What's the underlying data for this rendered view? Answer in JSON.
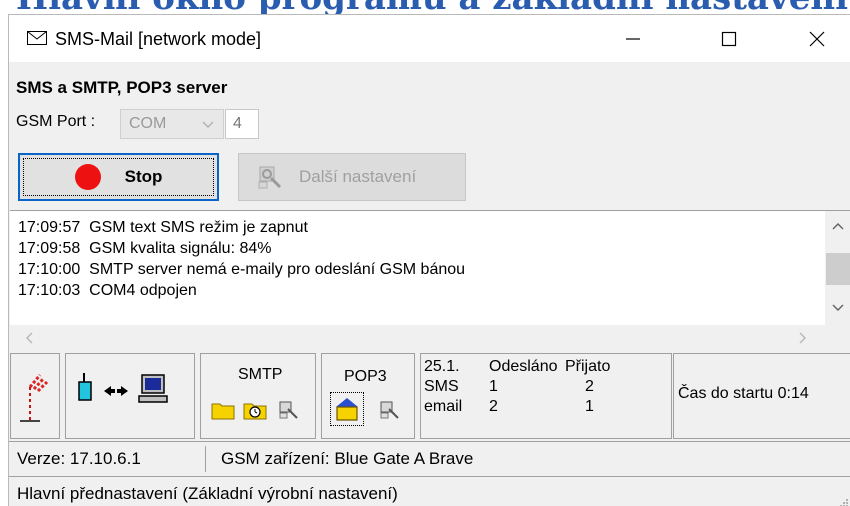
{
  "page": {
    "heading": "Hlavní okno programu a základní nastavení"
  },
  "window": {
    "title": "SMS-Mail  [network mode]"
  },
  "section": {
    "title": "SMS a SMTP, POP3 server"
  },
  "gsm_port": {
    "label": "GSM Port :",
    "select_value": "COM",
    "number": "4"
  },
  "buttons": {
    "stop": "Stop",
    "more_settings": "Další nastavení"
  },
  "log": {
    "lines": [
      "17:09:57  GSM text SMS režim je zapnut",
      "17:09:58  GSM kvalita signálu: 84%",
      "17:10:00  SMTP server nemá e-maily pro odeslání GSM bánou",
      "17:10:03  COM4 odpojen"
    ]
  },
  "panels": {
    "smtp_label": "SMTP",
    "pop3_label": "POP3",
    "stats": {
      "date": "25.1.",
      "sent_header": "Odesláno",
      "received_header": "Přijato",
      "rows": [
        {
          "label": "SMS",
          "sent": "1",
          "received": "2"
        },
        {
          "label": "email",
          "sent": "2",
          "received": "1"
        }
      ]
    },
    "countdown": "Čas do startu 0:14"
  },
  "status": {
    "version": "Verze: 17.10.6.1",
    "device": "GSM zařízení: Blue Gate A Brave",
    "preset": "Hlavní přednastavení (Základní výrobní nastavení)"
  },
  "colors": {
    "accent": "#0a63c9",
    "stop": "#ee1111",
    "heading": "#2a5db0",
    "folder": "#f6d300"
  }
}
